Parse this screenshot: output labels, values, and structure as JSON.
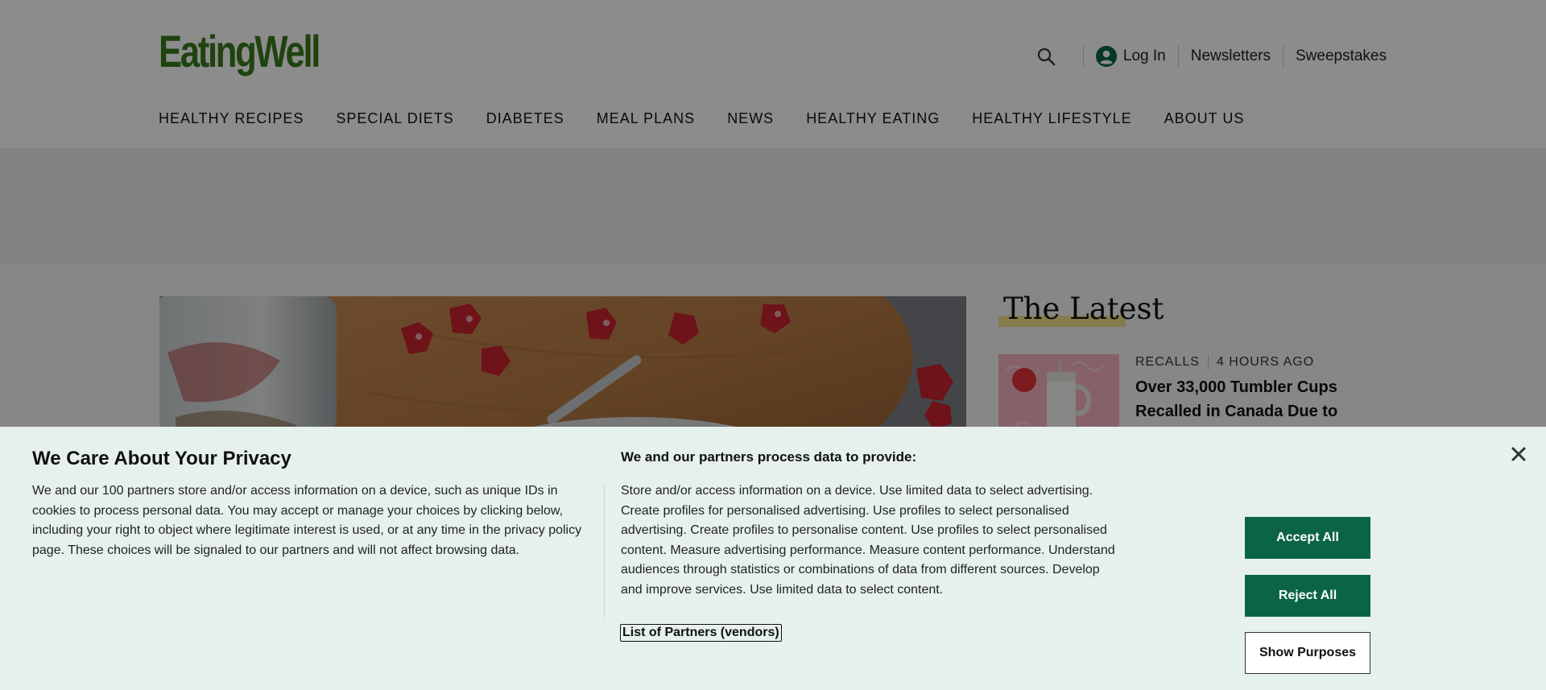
{
  "header": {
    "logo_text": "EatingWell",
    "brand_color": "#3a7a1c",
    "utility": {
      "search_icon": "search-icon",
      "login_icon": "account-circle-icon",
      "login_label": "Log In",
      "newsletters_label": "Newsletters",
      "sweepstakes_label": "Sweepstakes"
    },
    "nav": [
      "HEALTHY RECIPES",
      "SPECIAL DIETS",
      "DIABETES",
      "MEAL PLANS",
      "NEWS",
      "HEALTHY EATING",
      "HEALTHY LIFESTYLE",
      "ABOUT US"
    ]
  },
  "latest": {
    "title": "The Latest",
    "item": {
      "category": "RECALLS",
      "time": "4 HOURS AGO",
      "headline": "Over 33,000 Tumbler Cups Recalled in Canada Due to"
    }
  },
  "consent": {
    "title": "We Care About Your Privacy",
    "body": "We and our 100 partners store and/or access information on a device, such as unique IDs in cookies to process personal data. You may accept or manage your choices by clicking below, including your right to object where legitimate interest is used, or at any time in the privacy policy page. These choices will be signaled to our partners and will not affect browsing data.",
    "purposes_title": "We and our partners process data to provide:",
    "purposes_body": "Store and/or access information on a device. Use limited data to select advertising. Create profiles for personalised advertising. Use profiles to select personalised advertising. Create profiles to personalise content. Use profiles to select personalised content. Measure advertising performance. Measure content performance. Understand audiences through statistics or combinations of data from different sources. Develop and improve services. Use limited data to select content.",
    "partners_link": "List of Partners (vendors)",
    "accept_label": "Accept All",
    "reject_label": "Reject All",
    "show_purposes_label": "Show Purposes",
    "close_icon": "close-icon",
    "button_color": "#0b6447"
  }
}
